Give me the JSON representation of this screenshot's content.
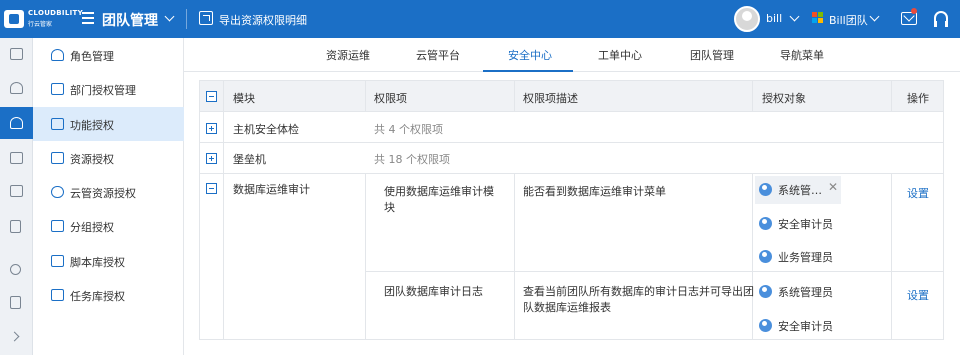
{
  "brand": {
    "name": "CLOUDBILITY",
    "sub": "行云管家"
  },
  "header": {
    "title": "团队管理",
    "export_label": "导出资源权限明细",
    "user_name": "bill",
    "team_name": "Bill团队",
    "colors": {
      "bar": "#1b6fc6",
      "notification": "#e94b3c"
    }
  },
  "rail": [
    {
      "icon": "document-icon"
    },
    {
      "icon": "users-icon"
    },
    {
      "icon": "user-permission-icon",
      "active": true
    },
    {
      "icon": "server-settings-icon"
    },
    {
      "icon": "mail-icon"
    },
    {
      "icon": "book-icon"
    },
    {
      "icon": "search-icon"
    },
    {
      "icon": "clipboard-icon"
    },
    {
      "icon": "chevron-right-icon"
    }
  ],
  "sidebar": {
    "items": [
      {
        "label": "角色管理",
        "icon": "role-icon"
      },
      {
        "label": "部门授权管理",
        "icon": "department-icon"
      },
      {
        "label": "功能授权",
        "icon": "function-icon",
        "active": true
      },
      {
        "label": "资源授权",
        "icon": "monitor-icon"
      },
      {
        "label": "云管资源授权",
        "icon": "cloud-icon"
      },
      {
        "label": "分组授权",
        "icon": "group-icon"
      },
      {
        "label": "脚本库授权",
        "icon": "script-icon"
      },
      {
        "label": "任务库授权",
        "icon": "task-icon"
      }
    ]
  },
  "tabs": [
    {
      "label": "资源运维"
    },
    {
      "label": "云管平台"
    },
    {
      "label": "安全中心",
      "active": true
    },
    {
      "label": "工单中心"
    },
    {
      "label": "团队管理"
    },
    {
      "label": "导航菜单"
    }
  ],
  "table": {
    "headers": {
      "module": "模块",
      "permission": "权限项",
      "description": "权限项描述",
      "grantee": "授权对象",
      "action": "操作"
    },
    "rows": {
      "host_security": {
        "name": "主机安全体检",
        "summary": "共 4 个权限项"
      },
      "bastion": {
        "name": "堡垒机",
        "summary": "共 18 个权限项"
      },
      "db_audit": {
        "name": "数据库运维审计",
        "items": [
          {
            "permission": "使用数据库运维审计模块",
            "permission_line1": "使用数据库运维审计模",
            "permission_line2": "块",
            "description": "能否看到数据库运维审计菜单",
            "grantees": [
              "系统管…",
              "安全审计员",
              "业务管理员"
            ],
            "action": "设置"
          },
          {
            "permission": "团队数据库审计日志",
            "description_line1": "查看当前团队所有数据库的审计日志并可导出团",
            "description_line2": "队数据库运维报表",
            "grantees": [
              "系统管理员",
              "安全审计员"
            ],
            "action": "设置"
          }
        ]
      }
    }
  }
}
